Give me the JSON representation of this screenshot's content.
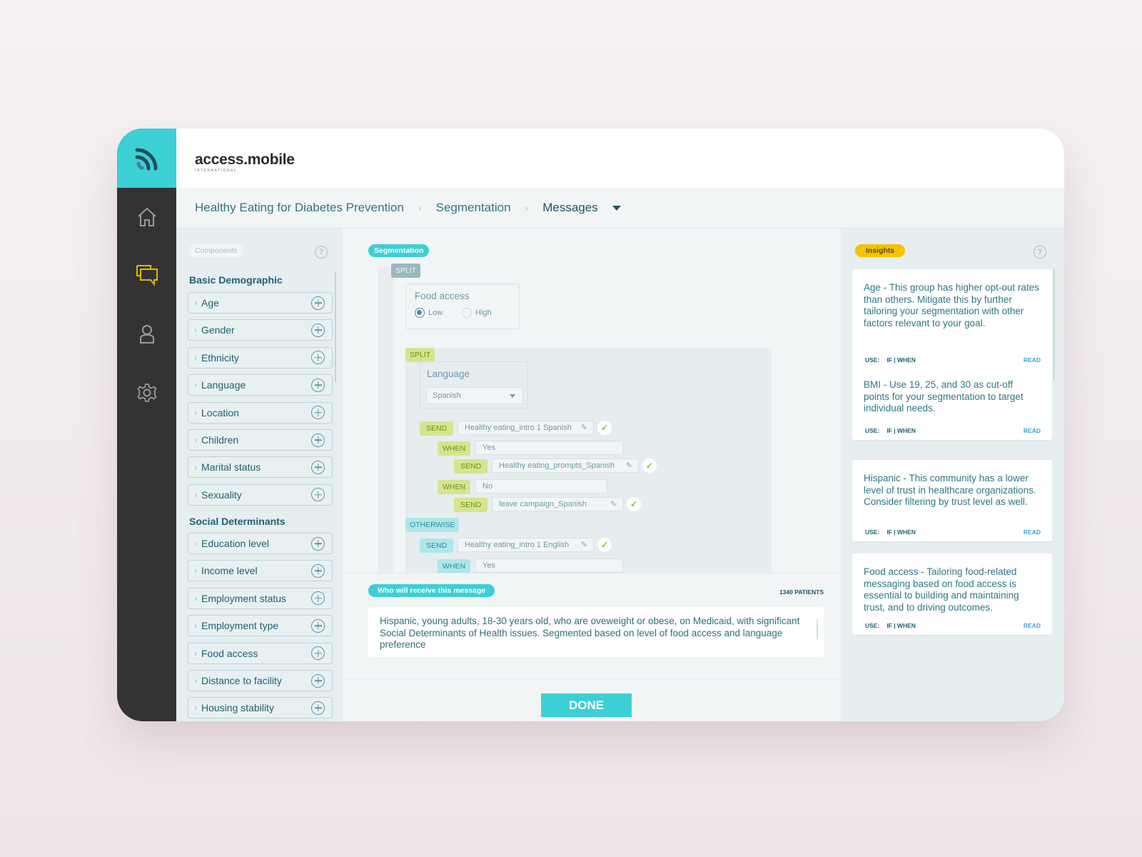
{
  "brand": {
    "name": "access.mobile",
    "subtitle": "INTERNATIONAL"
  },
  "nav": {
    "items": [
      {
        "name": "home",
        "icon": "home-icon",
        "active": false
      },
      {
        "name": "messages",
        "icon": "chat-icon",
        "active": true
      },
      {
        "name": "profile",
        "icon": "user-icon",
        "active": false
      },
      {
        "name": "settings",
        "icon": "gear-icon",
        "active": false
      }
    ],
    "active_color": "#e0b800"
  },
  "breadcrumb": {
    "items": [
      "Healthy Eating for Diabetes Prevention",
      "Segmentation",
      "Messages"
    ],
    "separator": "›"
  },
  "components": {
    "label": "Components",
    "help": "?",
    "sections": [
      {
        "title": "Basic Demographic",
        "items": [
          "Age",
          "Gender",
          "Ethnicity",
          "Language",
          "Location",
          "Children",
          "Marital status",
          "Sexuality"
        ]
      },
      {
        "title": "Social Determinants",
        "items": [
          "Education level",
          "Income level",
          "Employment status",
          "Employment type",
          "Food access",
          "Distance to facility",
          "Housing stability"
        ]
      }
    ]
  },
  "segmentation": {
    "label": "Segmentation",
    "split1": {
      "tag": "SPLIT",
      "title": "Food access",
      "options": [
        "Low",
        "High"
      ],
      "selected": "Low"
    },
    "split2": {
      "tag": "SPLIT",
      "title": "Language",
      "selected": "Spanish"
    },
    "rows": {
      "send1": {
        "tag": "SEND",
        "value": "Healthy eating_intro 1 Spanish"
      },
      "when1": {
        "tag": "WHEN",
        "value": "Yes"
      },
      "send2": {
        "tag": "SEND",
        "value": "Healthy eating_prompts_Spanish"
      },
      "when2": {
        "tag": "WHEN",
        "value": "No"
      },
      "send3": {
        "tag": "SEND",
        "value": "leave campaign_Spanish"
      },
      "otherwise": {
        "tag": "OTHERWISE"
      },
      "send4": {
        "tag": "SEND",
        "value": "Healthy eating_intro 1 English"
      },
      "when3": {
        "tag": "WHEN",
        "value": "Yes"
      }
    }
  },
  "receivers": {
    "label": "Who will receive this message",
    "count": "1340 PATIENTS",
    "description": "Hispanic, young adults, 18-30 years old, who are oveweight or obese, on Medicaid, with significant Social Determinants of Health issues. Segmented based on level of food access and language preference"
  },
  "actions": {
    "done": "DONE"
  },
  "insights": {
    "label": "Insights",
    "help": "?",
    "cards": [
      {
        "text": "Age - This group has higher opt-out rates than others. Mitigate this by further tailoring your segmentation with other factors relevant to your goal.",
        "use": "USE:",
        "conditions": "IF | WHEN",
        "action": "READ"
      },
      {
        "text": "BMI - Use 19, 25, and 30 as cut-off points for your segmentation to target individual needs.",
        "use": "USE:",
        "conditions": "IF | WHEN",
        "action": "READ"
      },
      {
        "text": "Hispanic - This community has a lower level of trust in healthcare organizations. Consider filtering by trust level as well.",
        "use": "USE:",
        "conditions": "IF | WHEN",
        "action": "READ"
      },
      {
        "text": "Food access - Tailoring food-related messaging based on food access is essential to building and maintaining trust, and to driving outcomes.",
        "use": "USE:",
        "conditions": "IF | WHEN",
        "action": "READ"
      }
    ]
  },
  "colors": {
    "accent": "#3ccfd6",
    "insights": "#f5c400",
    "rail": "#333333",
    "send_green": "#d6e58c",
    "otherwise_cyan": "#aee6ec"
  }
}
